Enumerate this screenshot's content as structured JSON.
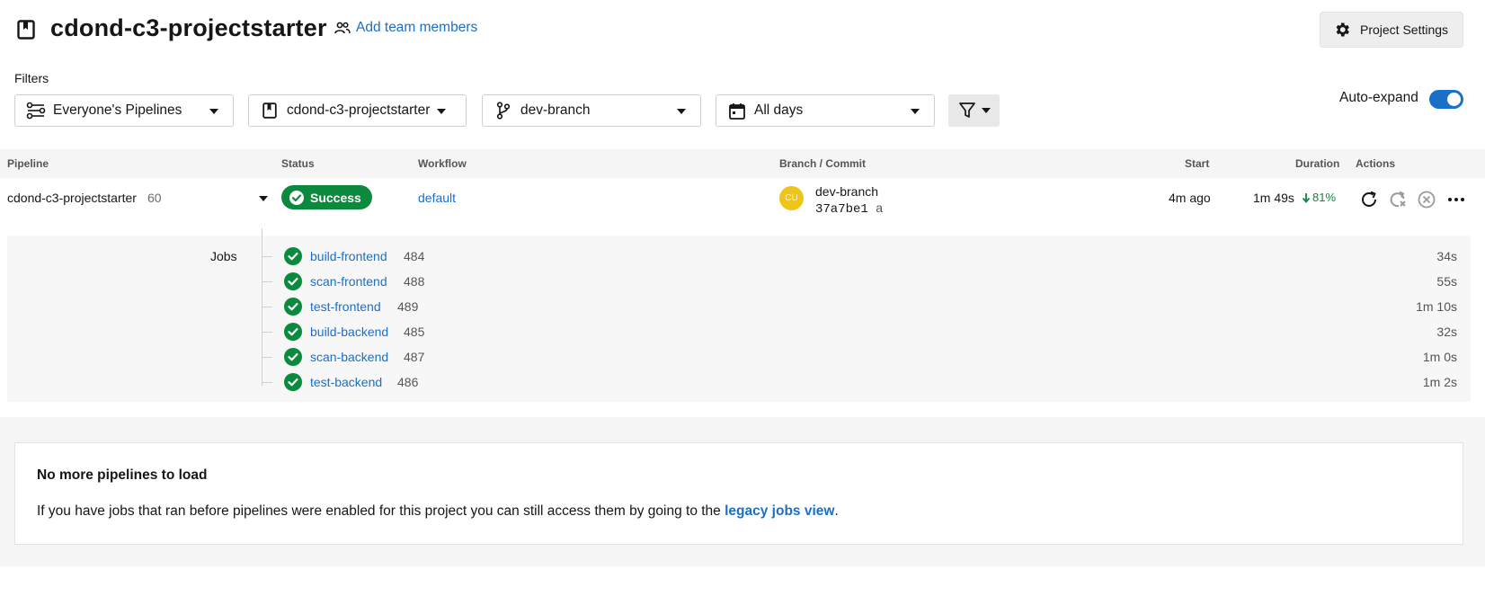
{
  "header": {
    "title": "cdond-c3-projectstarter",
    "add_team_label": "Add team members",
    "settings_label": "Project Settings"
  },
  "filters": {
    "label": "Filters",
    "pipelines": "Everyone's Pipelines",
    "project": "cdond-c3-projectstarter",
    "branch": "dev-branch",
    "days": "All days"
  },
  "auto_expand": {
    "label": "Auto-expand",
    "enabled": true
  },
  "table": {
    "headers": {
      "pipeline": "Pipeline",
      "status": "Status",
      "workflow": "Workflow",
      "branch_commit": "Branch / Commit",
      "start": "Start",
      "duration": "Duration",
      "actions": "Actions"
    }
  },
  "pipeline": {
    "name": "cdond-c3-projectstarter",
    "number": "60",
    "status": "Success",
    "workflow": "default",
    "avatar_initials": "CU",
    "branch": "dev-branch",
    "commit_hash": "37a7be1",
    "commit_message": "a",
    "start": "4m ago",
    "duration": "1m 49s",
    "duration_delta": "81%"
  },
  "jobs": {
    "label": "Jobs",
    "items": [
      {
        "name": "build-frontend",
        "number": "484",
        "duration": "34s"
      },
      {
        "name": "scan-frontend",
        "number": "488",
        "duration": "55s"
      },
      {
        "name": "test-frontend",
        "number": "489",
        "duration": "1m 10s"
      },
      {
        "name": "build-backend",
        "number": "485",
        "duration": "32s"
      },
      {
        "name": "scan-backend",
        "number": "487",
        "duration": "1m 0s"
      },
      {
        "name": "test-backend",
        "number": "486",
        "duration": "1m 2s"
      }
    ]
  },
  "info": {
    "title": "No more pipelines to load",
    "text_before": "If you have jobs that ran before pipelines were enabled for this project you can still access them by going to the ",
    "link": "legacy jobs view",
    "text_after": "."
  },
  "colors": {
    "accent": "#1a6fc9",
    "success": "#0b8a3e",
    "avatar": "#f0c419"
  }
}
